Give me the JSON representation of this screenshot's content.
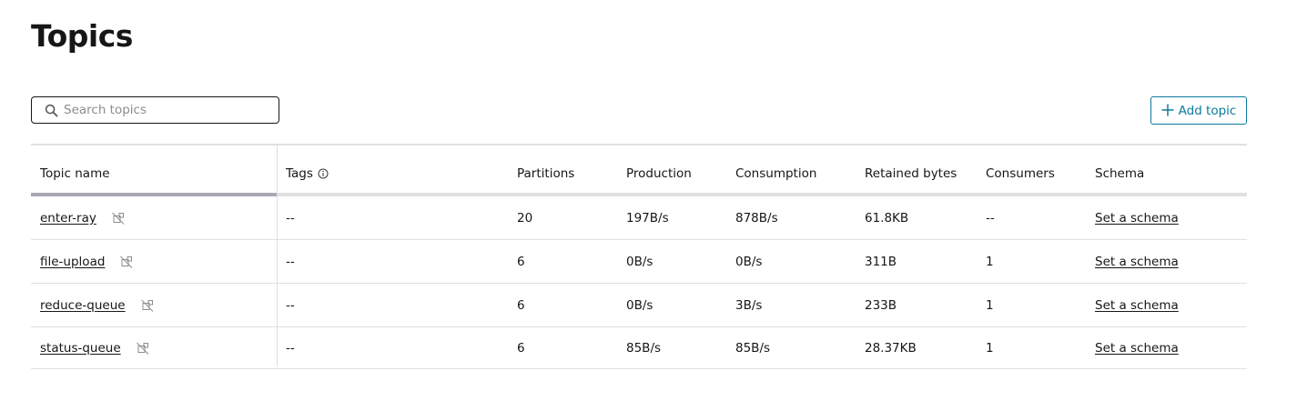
{
  "page": {
    "title": "Topics"
  },
  "search": {
    "placeholder": "Search topics",
    "value": "",
    "icon": "search-icon"
  },
  "toolbar": {
    "add_label": "Add topic",
    "add_icon": "plus-icon"
  },
  "table": {
    "columns": {
      "name": "Topic name",
      "tags": "Tags",
      "partitions": "Partitions",
      "production": "Production",
      "consumption": "Consumption",
      "retained": "Retained bytes",
      "consumers": "Consumers",
      "schema": "Schema"
    },
    "rows": [
      {
        "name": "enter-ray",
        "tags": "--",
        "partitions": "20",
        "production": "197B/s",
        "consumption": "878B/s",
        "retained": "61.8KB",
        "consumers": "--",
        "schema": "Set a schema"
      },
      {
        "name": "file-upload",
        "tags": "--",
        "partitions": "6",
        "production": "0B/s",
        "consumption": "0B/s",
        "retained": "311B",
        "consumers": "1",
        "schema": "Set a schema"
      },
      {
        "name": "reduce-queue",
        "tags": "--",
        "partitions": "6",
        "production": "0B/s",
        "consumption": "3B/s",
        "retained": "233B",
        "consumers": "1",
        "schema": "Set a schema"
      },
      {
        "name": "status-queue",
        "tags": "--",
        "partitions": "6",
        "production": "85B/s",
        "consumption": "85B/s",
        "retained": "28.37KB",
        "consumers": "1",
        "schema": "Set a schema"
      }
    ]
  },
  "colors": {
    "accent": "#0b7a9e",
    "text": "#161616",
    "border": "#e0e0e0",
    "placeholder": "#8d8d8d"
  }
}
